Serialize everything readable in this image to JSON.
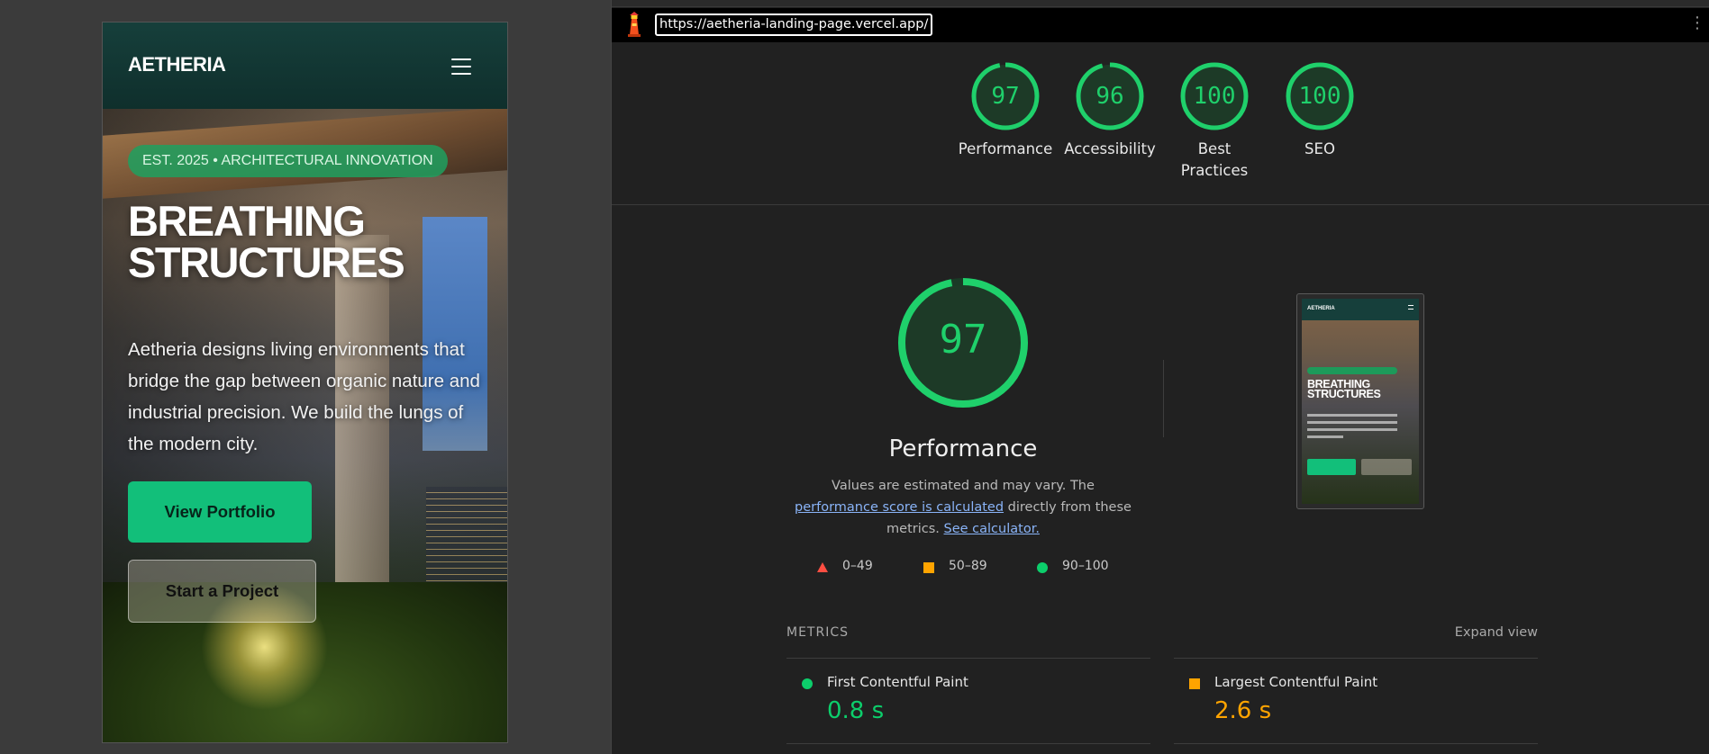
{
  "preview": {
    "brand": "AETHERIA",
    "badge": "EST. 2025 • ARCHITECTURAL INNOVATION",
    "title": "BREATHING STRUCTURES",
    "description": "Aetheria designs living environments that bridge the gap between organic nature and industrial precision. We build the lungs of the modern city.",
    "primary_button": "View Portfolio",
    "secondary_button": "Start a Project"
  },
  "report": {
    "url": "https://aetheria-landing-page.vercel.app/",
    "categories": [
      {
        "label": "Performance",
        "score": 97
      },
      {
        "label": "Accessibility",
        "score": 96
      },
      {
        "label": "Best Practices",
        "score": 100
      },
      {
        "label": "SEO",
        "score": 100
      }
    ],
    "performance": {
      "score": 97,
      "title": "Performance",
      "desc_prefix": "Values are estimated and may vary. The ",
      "link1": "performance score is calculated",
      "desc_middle": " directly from these metrics. ",
      "link2": "See calculator."
    },
    "legend": [
      {
        "range": "0–49",
        "shape": "triangle",
        "color": "#ff4e42"
      },
      {
        "range": "50–89",
        "shape": "square",
        "color": "#ffa400"
      },
      {
        "range": "90–100",
        "shape": "circle",
        "color": "#0cce6b"
      }
    ],
    "thumbnail": {
      "brand": "AETHERIA",
      "title": "BREATHING STRUCTURES"
    },
    "metrics_label": "METRICS",
    "expand_label": "Expand view",
    "metrics": [
      {
        "name": "First Contentful Paint",
        "value": "0.8 s",
        "status": "pass",
        "color": "#0cce6b"
      },
      {
        "name": "Largest Contentful Paint",
        "value": "2.6 s",
        "status": "average",
        "color": "#ffa400"
      }
    ]
  },
  "colors": {
    "pass": "#0cce6b",
    "average": "#ffa400",
    "fail": "#ff4e42",
    "brand_green": "#12bf7a"
  }
}
